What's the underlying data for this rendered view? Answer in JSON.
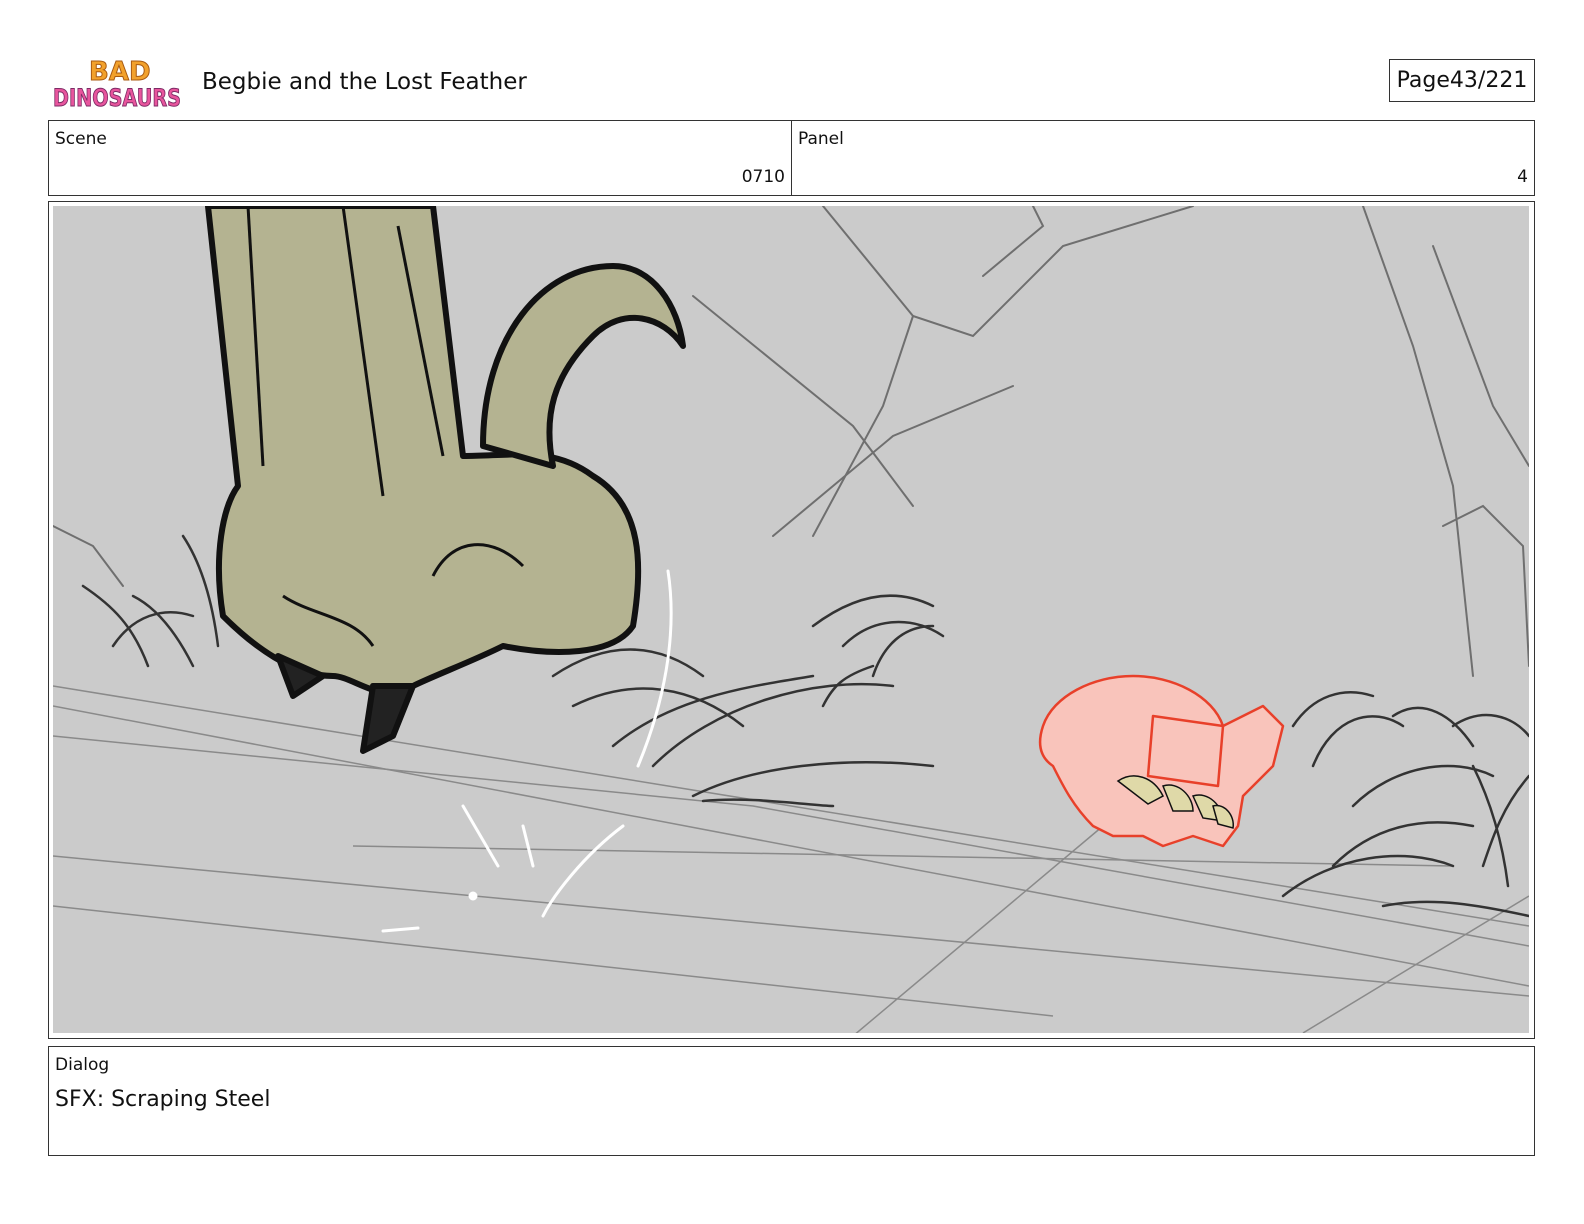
{
  "header": {
    "logo_text": "BAD DINOSAURS",
    "title": "Begbie and the Lost Feather",
    "page_label": "Page",
    "page_value": "43/221"
  },
  "info": {
    "scene_label": "Scene",
    "scene_value": "0710",
    "panel_label": "Panel",
    "panel_value": "4"
  },
  "dialog": {
    "label": "Dialog",
    "text": "SFX: Scraping Steel"
  },
  "colors": {
    "background_gray": "#cbcbcb",
    "dino_olive": "#b4b391",
    "sketch_red": "#f9c4bb",
    "line_red": "#e8402a"
  }
}
